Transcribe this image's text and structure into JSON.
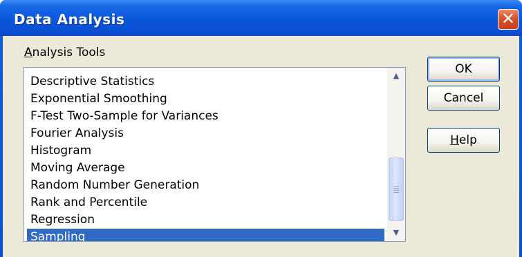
{
  "window": {
    "title": "Data Analysis"
  },
  "analysis_tools": {
    "label_mnemonic": "A",
    "label_rest": "nalysis Tools",
    "items": [
      "Descriptive Statistics",
      "Exponential Smoothing",
      "F-Test Two-Sample for Variances",
      "Fourier Analysis",
      "Histogram",
      "Moving Average",
      "Random Number Generation",
      "Rank and Percentile",
      "Regression",
      "Sampling"
    ],
    "selected": "Sampling"
  },
  "buttons": {
    "ok": "OK",
    "cancel": "Cancel",
    "help_mnemonic": "H",
    "help_rest": "elp"
  },
  "icons": {
    "close": "close-icon",
    "scroll_up": "scroll-up-arrow-icon",
    "scroll_down": "scroll-down-arrow-icon"
  },
  "colors": {
    "titlebar": "#0a56dc",
    "selection": "#316ac5",
    "dialog_bg": "#ece9d8"
  }
}
